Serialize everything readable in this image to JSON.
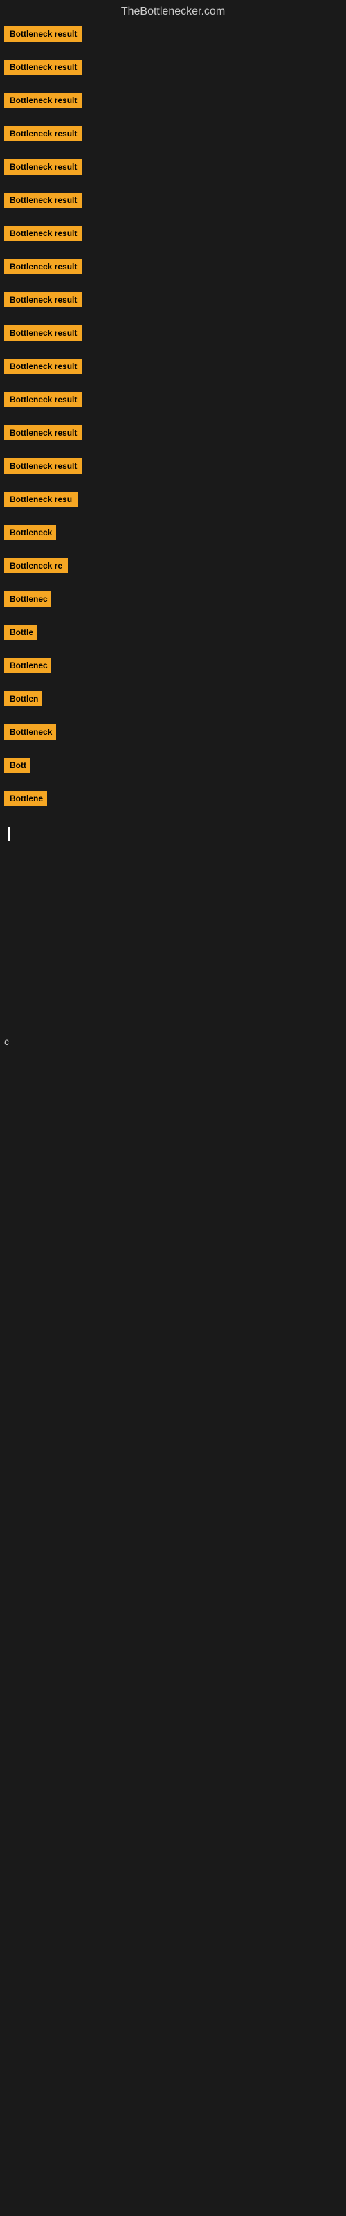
{
  "site": {
    "title": "TheBottlenecker.com"
  },
  "items": [
    {
      "id": 1,
      "label": "Bottleneck result",
      "width": 140
    },
    {
      "id": 2,
      "label": "Bottleneck result",
      "width": 140
    },
    {
      "id": 3,
      "label": "Bottleneck result",
      "width": 140
    },
    {
      "id": 4,
      "label": "Bottleneck result",
      "width": 140
    },
    {
      "id": 5,
      "label": "Bottleneck result",
      "width": 140
    },
    {
      "id": 6,
      "label": "Bottleneck result",
      "width": 140
    },
    {
      "id": 7,
      "label": "Bottleneck result",
      "width": 140
    },
    {
      "id": 8,
      "label": "Bottleneck result",
      "width": 140
    },
    {
      "id": 9,
      "label": "Bottleneck result",
      "width": 140
    },
    {
      "id": 10,
      "label": "Bottleneck result",
      "width": 140
    },
    {
      "id": 11,
      "label": "Bottleneck result",
      "width": 140
    },
    {
      "id": 12,
      "label": "Bottleneck result",
      "width": 140
    },
    {
      "id": 13,
      "label": "Bottleneck result",
      "width": 140
    },
    {
      "id": 14,
      "label": "Bottleneck result",
      "width": 140
    },
    {
      "id": 15,
      "label": "Bottleneck resu",
      "width": 118
    },
    {
      "id": 16,
      "label": "Bottleneck",
      "width": 75
    },
    {
      "id": 17,
      "label": "Bottleneck re",
      "width": 98
    },
    {
      "id": 18,
      "label": "Bottlenec",
      "width": 68
    },
    {
      "id": 19,
      "label": "Bottle",
      "width": 48
    },
    {
      "id": 20,
      "label": "Bottlenec",
      "width": 68
    },
    {
      "id": 21,
      "label": "Bottlen",
      "width": 55
    },
    {
      "id": 22,
      "label": "Bottleneck",
      "width": 75
    },
    {
      "id": 23,
      "label": "Bott",
      "width": 38
    },
    {
      "id": 24,
      "label": "Bottlene",
      "width": 62
    }
  ],
  "cursor": true,
  "bottom_char": "c"
}
